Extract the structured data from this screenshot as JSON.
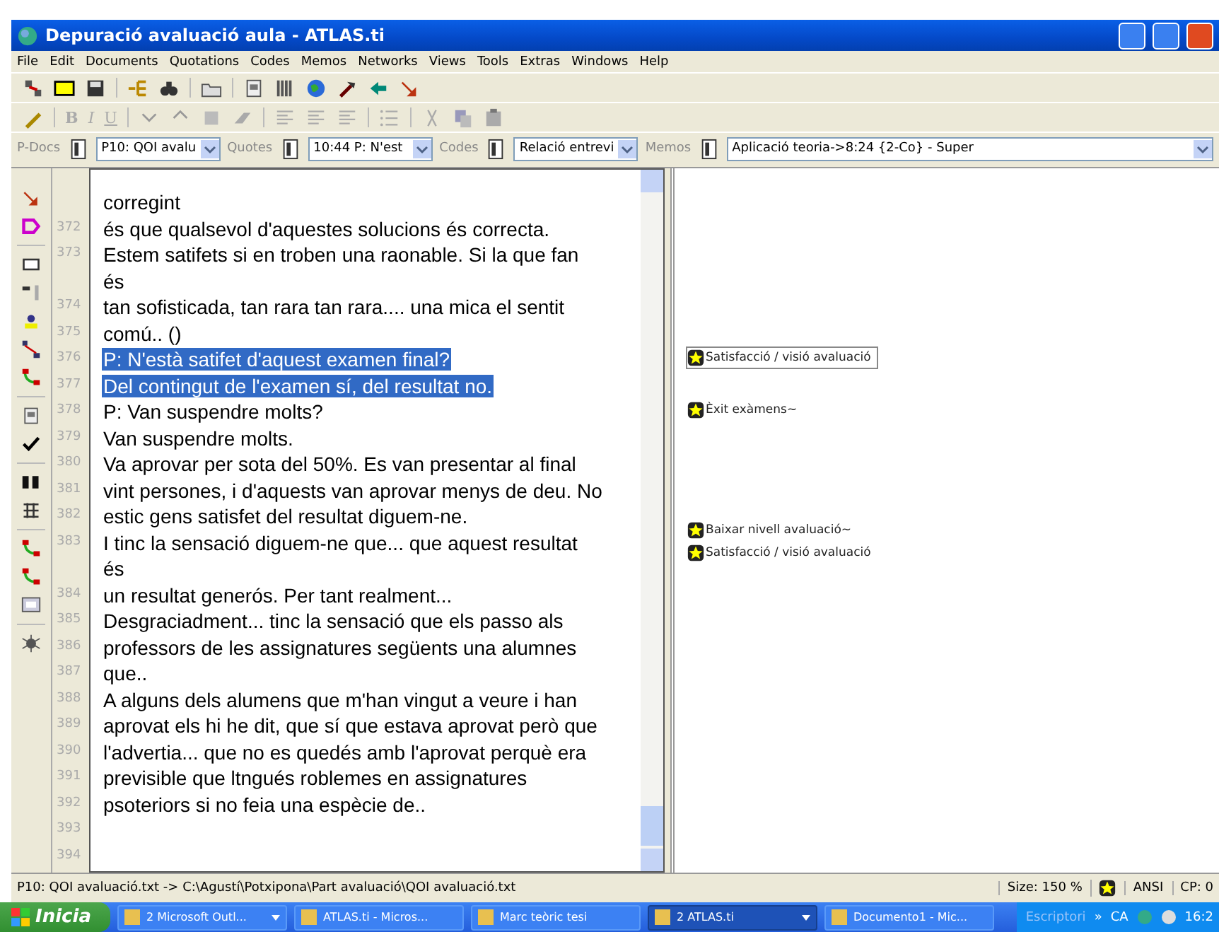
{
  "window": {
    "title": "Depuració avaluació aula - ATLAS.ti"
  },
  "menu": [
    "File",
    "Edit",
    "Documents",
    "Quotations",
    "Codes",
    "Memos",
    "Networks",
    "Views",
    "Tools",
    "Extras",
    "Windows",
    "Help"
  ],
  "format_buttons": [
    {
      "label": "B",
      "disabled": true
    },
    {
      "label": "I",
      "disabled": true
    },
    {
      "label": "U",
      "disabled": true
    }
  ],
  "selectors": [
    {
      "label": "P-Docs",
      "value": "P10: QOI avalu"
    },
    {
      "label": "Quotes",
      "value": "10:44 P: N'est"
    },
    {
      "label": "Codes",
      "value": "Relació entrevi"
    },
    {
      "label": "Memos",
      "value": "Aplicació teoria->8:24 {2-Co} - Super"
    }
  ],
  "document": {
    "lines": [
      {
        "text": "corregint",
        "selected": false
      },
      {
        "number": "372",
        "text": "és que qualsevol d'aquestes solucions és correcta.",
        "selected": false
      },
      {
        "number": "373",
        "text": "Estem satifets si en troben una raonable. Si la que fan",
        "selected": false
      },
      {
        "text": "és",
        "selected": false
      },
      {
        "number": "374",
        "text": "tan sofisticada, tan rara tan rara.... una mica el sentit",
        "selected": false
      },
      {
        "number": "375",
        "text": "comú.. ()",
        "selected": false
      },
      {
        "number": "376",
        "text": "P: N'està satifet d'aquest examen final?",
        "selected": true,
        "codes": [
          {
            "label": "Satisfacció / visió avaluació",
            "selected": true
          }
        ]
      },
      {
        "number": "377",
        "text": "Del contingut de l'examen sí, del resultat no.",
        "selected": true
      },
      {
        "number": "378",
        "text": "P: Van suspendre molts?",
        "selected": false,
        "codes": [
          {
            "label": "Èxit exàmens~",
            "selected": false
          }
        ]
      },
      {
        "number": "379",
        "text": "Van suspendre molts.",
        "selected": false
      },
      {
        "number": "380",
        "text": "Va aprovar per sota del 50%. Es van presentar al final",
        "selected": false
      },
      {
        "number": "381",
        "text": "vint persones, i d'aquests van aprovar menys de deu. No",
        "selected": false
      },
      {
        "number": "382",
        "text": "estic gens satisfet del resultat diguem-ne.",
        "selected": false
      },
      {
        "number": "383",
        "text": "I tinc la sensació diguem-ne que... que aquest resultat",
        "selected": false,
        "codes": [
          {
            "label": "Baixar nivell avaluació~",
            "selected": false
          },
          {
            "label": "Satisfacció / visió avaluació",
            "selected": false
          }
        ]
      },
      {
        "text": "és",
        "selected": false
      },
      {
        "number": "384",
        "text": "un resultat generós. Per tant realment...",
        "selected": false
      },
      {
        "number": "385",
        "text": "Desgraciadment... tinc la sensació que els passo als",
        "selected": false
      },
      {
        "number": "386",
        "text": "professors de les assignatures següents una alumnes",
        "selected": false
      },
      {
        "number": "387",
        "text": "que..",
        "selected": false
      },
      {
        "number": "388",
        "text": "A alguns dels alumens que m'han vingut a veure i han",
        "selected": false
      },
      {
        "number": "389",
        "text": "aprovat els hi he dit, que sí que estava aprovat però que",
        "selected": false
      },
      {
        "number": "390",
        "text": "l'advertia... que no es quedés amb l'aprovat perquè era",
        "selected": false
      },
      {
        "number": "391",
        "text": "previsible que ltngués roblemes en assignatures",
        "selected": false
      },
      {
        "number": "392",
        "text": "psoteriors si no feia una espècie de..",
        "selected": false
      },
      {
        "number": "393"
      },
      {
        "number": "394"
      }
    ]
  },
  "status_bar": {
    "path": "P10: QOI avaluació.txt -> C:\\Agustí\\Potxipona\\Part avaluació\\QOI avaluació.txt",
    "size": "Size: 150 %",
    "encoding": "ANSI",
    "position": "CP: 0"
  },
  "taskbar": {
    "start": "Inicia",
    "tasks": [
      {
        "label": "2 Microsoft Outl...",
        "active": false,
        "grouped": true
      },
      {
        "label": "ATLAS.ti - Micros...",
        "active": false,
        "grouped": false
      },
      {
        "label": "Marc teòric tesi",
        "active": false,
        "grouped": false
      },
      {
        "label": "2 ATLAS.ti",
        "active": true,
        "grouped": true
      },
      {
        "label": "Documento1 - Mic...",
        "active": false,
        "grouped": false
      }
    ],
    "desktop": "Escriptori",
    "more": "»",
    "language": "CA",
    "clock": "16:2"
  }
}
